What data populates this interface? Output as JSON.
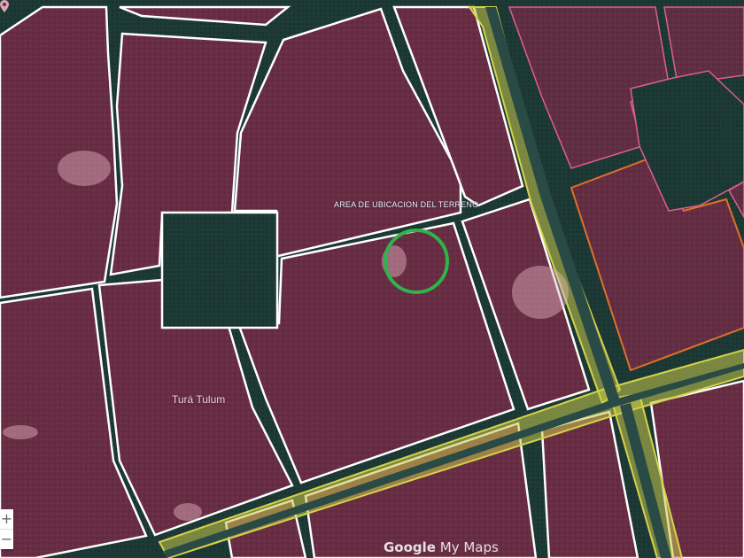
{
  "map": {
    "area_label": "AREA DE UBICACION DEL TERRENO",
    "poi_label": "Turá Tulum",
    "brand_google": "Google",
    "brand_mymaps": "My Maps",
    "zoom_in": "+",
    "zoom_out": "−",
    "icons": [
      "location-pin-icon",
      "zoom-in-icon",
      "zoom-out-icon"
    ],
    "colors": {
      "parcel_fill": "#6e2d45",
      "parcel_border": "#ffffff",
      "forest": "#1f3d38",
      "highway_highlight": "#c9c94a",
      "highway_border": "#d4d24a",
      "target_circle": "#2fb34a",
      "orange_border": "#e0702a"
    }
  }
}
